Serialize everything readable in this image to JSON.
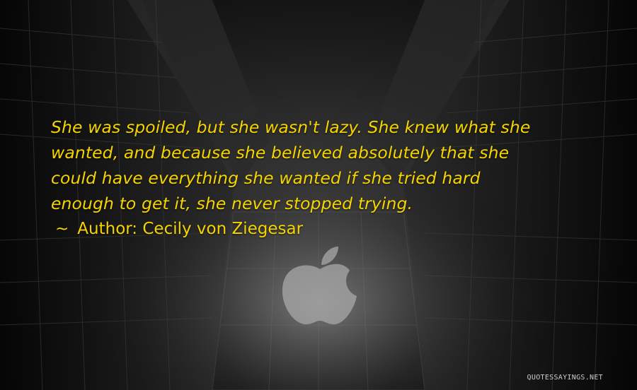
{
  "quote": {
    "lines": [
      "She was spoiled, but she wasn't lazy. She knew what she",
      "wanted, and because she believed absolutely that she",
      "could have everything she wanted if she tried hard",
      "enough to get it, she never stopped trying."
    ],
    "author_prefix": "~",
    "author_label": "Author: Cecily von Ziegesar",
    "text_color": "#f5d400"
  },
  "watermark": {
    "text": "QUOTESSAYINGS.NET"
  },
  "background": {
    "icon": "apple-logo-icon",
    "description_color": "#1c1c1c"
  }
}
